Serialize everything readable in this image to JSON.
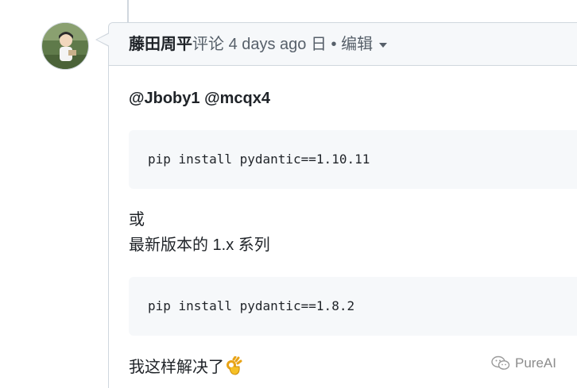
{
  "comment": {
    "author": "藤田周平",
    "action": "评论",
    "time": "4 days ago",
    "date_suffix": "日",
    "separator": "•",
    "edit_label": "编辑",
    "mentions": "@Jboby1 @mcqx4",
    "code_1": "pip install pydantic==1.10.11",
    "text_or": "或",
    "text_latest": "最新版本的 1.x 系列",
    "code_2": "pip install pydantic==1.8.2",
    "text_solved": "我这样解决了",
    "emoji": "ok-hand-emoji"
  },
  "watermark": {
    "text": "PureAI",
    "icon": "wechat-icon"
  },
  "colors": {
    "border": "#d0d7de",
    "header_bg": "#f6f8fa",
    "code_bg": "#f6f8fa",
    "text": "#1f2328",
    "muted": "#57606a"
  }
}
